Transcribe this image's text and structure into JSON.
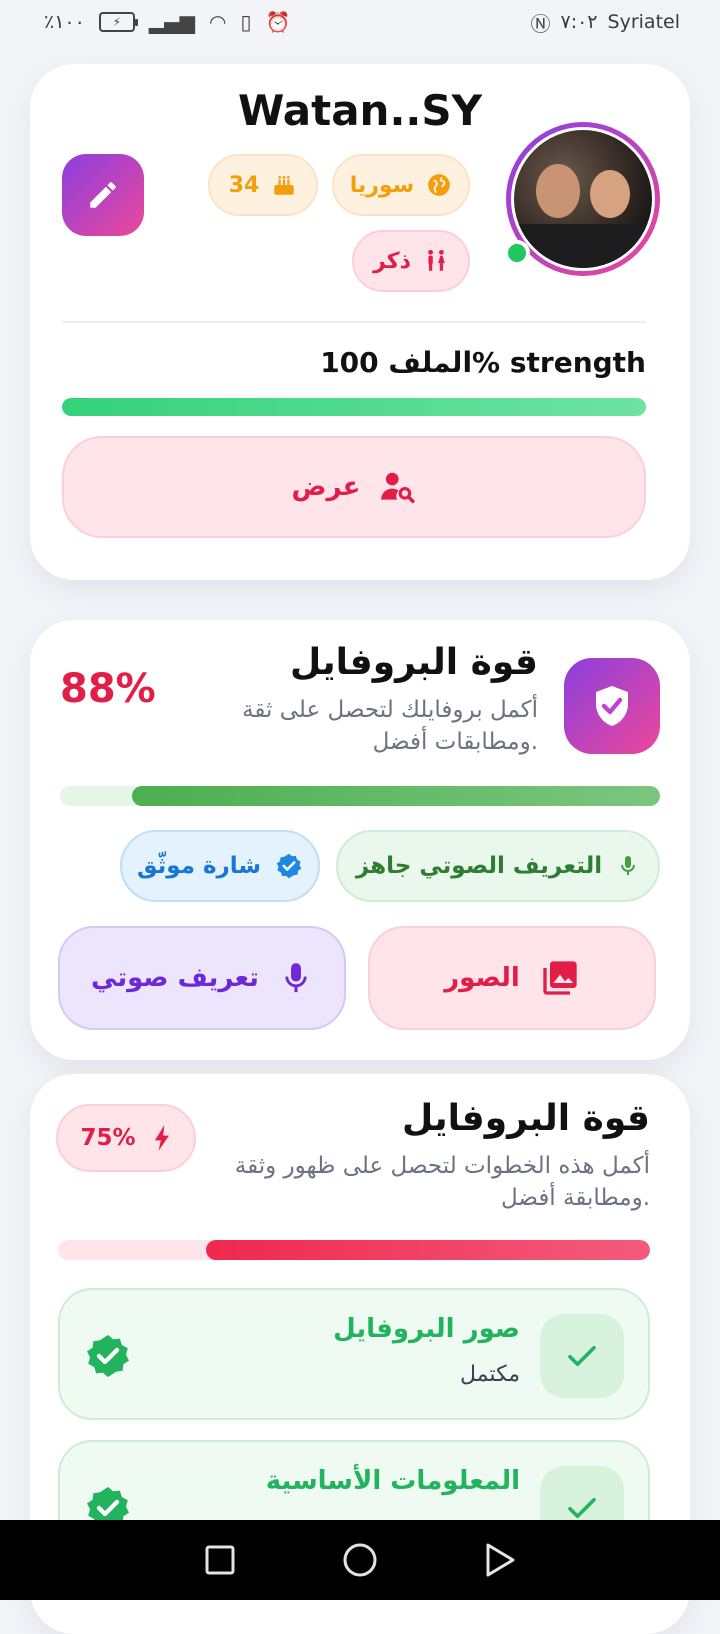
{
  "status_bar": {
    "battery_percent": "٪١٠٠",
    "time": "٧:٠٢",
    "carrier": "Syriatel"
  },
  "profile": {
    "username": "Watan..SY",
    "country": "سوريا",
    "age": "34",
    "gender": "ذكر",
    "online": true,
    "strength_label": "الملف 100% strength",
    "strength_percent": 100,
    "view_button": "عرض"
  },
  "profile_power": {
    "title": "قوة البروفايل",
    "subtitle": "أكمل بروفايلك لتحصل على ثقة ومطابقات أفضل.",
    "percent_label": "88%",
    "percent": 88,
    "voice_ready": "التعريف الصوتي جاهز",
    "verified_badge": "شارة موثّق",
    "photos_button": "الصور",
    "voice_intro_button": "تعريف صوتي"
  },
  "profile_steps": {
    "title": "قوة البروفايل",
    "subtitle": "أكمل هذه الخطوات لتحصل على ظهور وثقة ومطابقة أفضل.",
    "percent_label": "75%",
    "percent": 75,
    "steps": [
      {
        "title": "صور البروفايل",
        "status": "مكتمل"
      },
      {
        "title": "المعلومات الأساسية",
        "status": ""
      }
    ]
  },
  "colors": {
    "accent_pink": "#e11d48",
    "brand_gradient_start": "#8b3fe0",
    "brand_gradient_end": "#ec4899",
    "success_green": "#22c55e"
  }
}
